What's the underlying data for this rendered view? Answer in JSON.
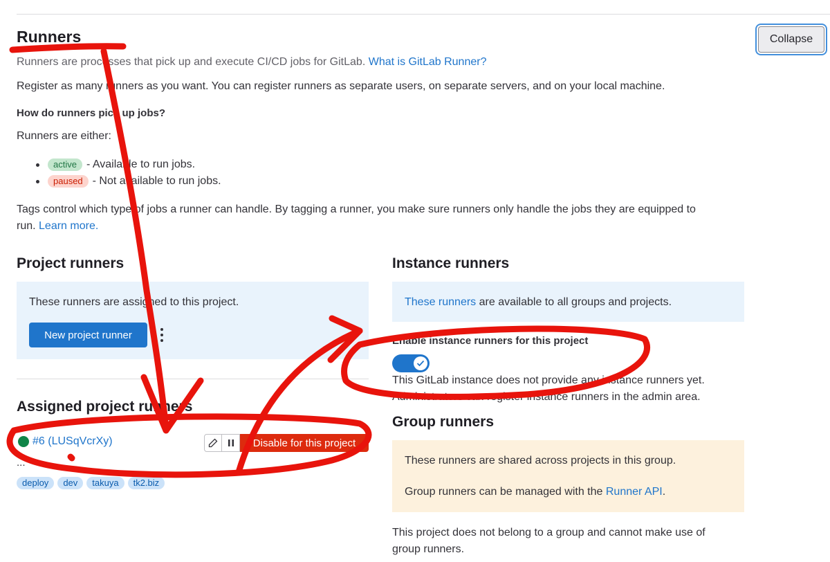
{
  "header": {
    "title": "Runners",
    "collapse_label": "Collapse"
  },
  "intro": {
    "line1_text": "Runners are processes that pick up and execute CI/CD jobs for GitLab.",
    "line1_link": "What is GitLab Runner?",
    "line2": "Register as many runners as you want. You can register runners as separate users, on separate servers, and on your local machine.",
    "question": "How do runners pick up jobs?",
    "either": "Runners are either:",
    "statuses": [
      {
        "badge": "active",
        "text": "- Available to run jobs."
      },
      {
        "badge": "paused",
        "text": "- Not available to run jobs."
      }
    ],
    "tags_line1": "Tags control which type of jobs a runner can handle. By tagging a runner, you make sure runners only handle the jobs they are equipped to",
    "tags_line2": "run.",
    "learn_more": "Learn more."
  },
  "project_runners": {
    "title": "Project runners",
    "description": "These runners are assigned to this project.",
    "new_button": "New project runner",
    "menu_icon": "kebab-icon"
  },
  "assigned": {
    "title": "Assigned project runners",
    "runner": {
      "status_color": "#108548",
      "name": "#6 (LUSqVcrXy)",
      "description": "...",
      "edit_icon": "pencil-icon",
      "pause_icon": "pause-icon",
      "disable_label": "Disable for this project",
      "tags": [
        "deploy",
        "dev",
        "takuya",
        "tk2.biz"
      ]
    }
  },
  "instance_runners": {
    "title": "Instance runners",
    "link": "These runners",
    "description": "are available to all groups and projects.",
    "toggle_label": "Enable instance runners for this project",
    "toggle_on": true,
    "note1": "This GitLab instance does not provide any instance runners yet.",
    "note2": "Administrators can register instance runners in the admin area."
  },
  "group_runners": {
    "title": "Group runners",
    "line1": "These runners are shared across projects in this group.",
    "line2_text": "Group runners can be managed with the",
    "line2_link": "Runner API",
    "line2_end": ".",
    "footer1": "This project does not belong to a group and cannot make use of",
    "footer2": "group runners."
  },
  "colors": {
    "accent": "#1f75cb",
    "danger": "#dd2b0e",
    "annotation": "#e8140c"
  }
}
